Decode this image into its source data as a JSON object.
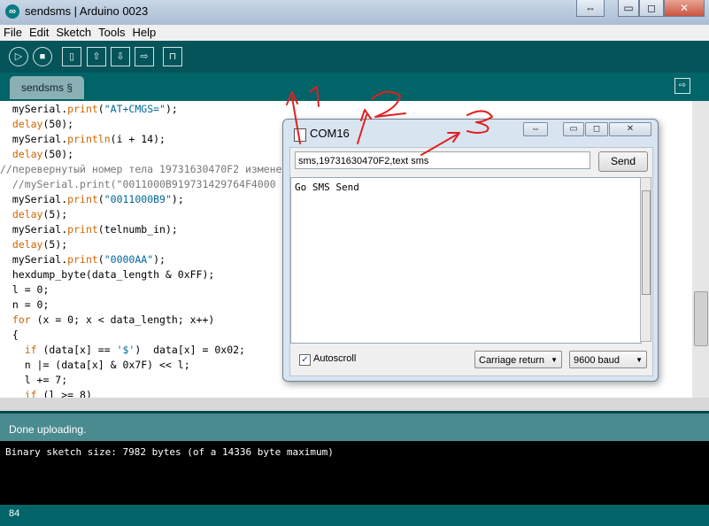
{
  "window": {
    "title": "sendsms | Arduino 0023",
    "app_icon": "arduino-logo-icon"
  },
  "window_buttons": {
    "restore": "⇔",
    "minimize": "▭",
    "maximize": "◻",
    "close": "✕"
  },
  "menu": [
    "File",
    "Edit",
    "Sketch",
    "Tools",
    "Help"
  ],
  "toolbar": {
    "icons": [
      "verify-icon",
      "stop-icon",
      "new-icon",
      "open-icon",
      "save-icon",
      "upload-icon",
      "serial-monitor-icon"
    ],
    "glyphs": [
      "▷",
      "■",
      "▯",
      "⇧",
      "⇩",
      "⇨",
      "⊓"
    ]
  },
  "tabs": [
    {
      "label": "sendsms §"
    }
  ],
  "tab_menu_glyph": "⇨",
  "code": {
    "lines": [
      [
        {
          "t": "  mySerial.",
          "c": ""
        },
        {
          "t": "print",
          "c": "kw"
        },
        {
          "t": "(",
          "c": ""
        },
        {
          "t": "\"AT+CMGS=\"",
          "c": "st"
        },
        {
          "t": ");",
          "c": ""
        }
      ],
      [
        {
          "t": "  ",
          "c": ""
        },
        {
          "t": "delay",
          "c": "kw"
        },
        {
          "t": "(50);",
          "c": ""
        }
      ],
      [
        {
          "t": "  mySerial.",
          "c": ""
        },
        {
          "t": "println",
          "c": "kw"
        },
        {
          "t": "(i + 14);",
          "c": ""
        }
      ],
      [
        {
          "t": "  ",
          "c": ""
        },
        {
          "t": "delay",
          "c": "kw"
        },
        {
          "t": "(50);",
          "c": ""
        }
      ],
      [
        {
          "t": "//перевернутый номер тела 19731630470F2 измене",
          "c": "cm"
        }
      ],
      [
        {
          "t": "  //mySerial.print(\"0011000B919731429764F4000",
          "c": "cm"
        }
      ],
      [
        {
          "t": "  mySerial.",
          "c": ""
        },
        {
          "t": "print",
          "c": "kw"
        },
        {
          "t": "(",
          "c": ""
        },
        {
          "t": "\"0011000B9\"",
          "c": "st"
        },
        {
          "t": ");",
          "c": ""
        }
      ],
      [
        {
          "t": "  ",
          "c": ""
        },
        {
          "t": "delay",
          "c": "kw"
        },
        {
          "t": "(5);",
          "c": ""
        }
      ],
      [
        {
          "t": "  mySerial.",
          "c": ""
        },
        {
          "t": "print",
          "c": "kw"
        },
        {
          "t": "(telnumb_in);",
          "c": ""
        }
      ],
      [
        {
          "t": "  ",
          "c": ""
        },
        {
          "t": "delay",
          "c": "kw"
        },
        {
          "t": "(5);",
          "c": ""
        }
      ],
      [
        {
          "t": "  mySerial.",
          "c": ""
        },
        {
          "t": "print",
          "c": "kw"
        },
        {
          "t": "(",
          "c": ""
        },
        {
          "t": "\"0000AA\"",
          "c": "st"
        },
        {
          "t": ");",
          "c": ""
        }
      ],
      [
        {
          "t": "  hexdump_byte(data_length & 0xFF);",
          "c": ""
        }
      ],
      [
        {
          "t": "  l = 0;",
          "c": ""
        }
      ],
      [
        {
          "t": "  n = 0;",
          "c": ""
        }
      ],
      [
        {
          "t": "  ",
          "c": ""
        },
        {
          "t": "for",
          "c": "kw"
        },
        {
          "t": " (x = 0; x < data_length; x++)",
          "c": ""
        }
      ],
      [
        {
          "t": "  {",
          "c": ""
        }
      ],
      [
        {
          "t": "    ",
          "c": ""
        },
        {
          "t": "if",
          "c": "kw"
        },
        {
          "t": " (data[x] == ",
          "c": ""
        },
        {
          "t": "'$'",
          "c": "st"
        },
        {
          "t": ")  data[x] = 0x02;",
          "c": ""
        }
      ],
      [
        {
          "t": "    n |= (data[x] & 0x7F) << l;",
          "c": ""
        }
      ],
      [
        {
          "t": "    l += 7;",
          "c": ""
        }
      ],
      [
        {
          "t": "    ",
          "c": ""
        },
        {
          "t": "if",
          "c": "kw"
        },
        {
          "t": " (l >= 8)",
          "c": ""
        }
      ]
    ]
  },
  "status": {
    "message": "Done uploading."
  },
  "console": {
    "text": "Binary sketch size: 7982 bytes (of a 14336 byte maximum)"
  },
  "line_number": "84",
  "serial_monitor": {
    "title": "COM16",
    "input_value": "sms,19731630470F2,text sms",
    "send_label": "Send",
    "output_text": "Go SMS Send",
    "autoscroll_label": "Autoscroll",
    "autoscroll_checked": "✓",
    "line_ending": "Carriage return",
    "baud_rate": "9600 baud",
    "dropdown_glyph": "▼"
  },
  "annotations": {
    "labels": [
      "1",
      "2",
      "3"
    ],
    "color": "#e02020"
  }
}
